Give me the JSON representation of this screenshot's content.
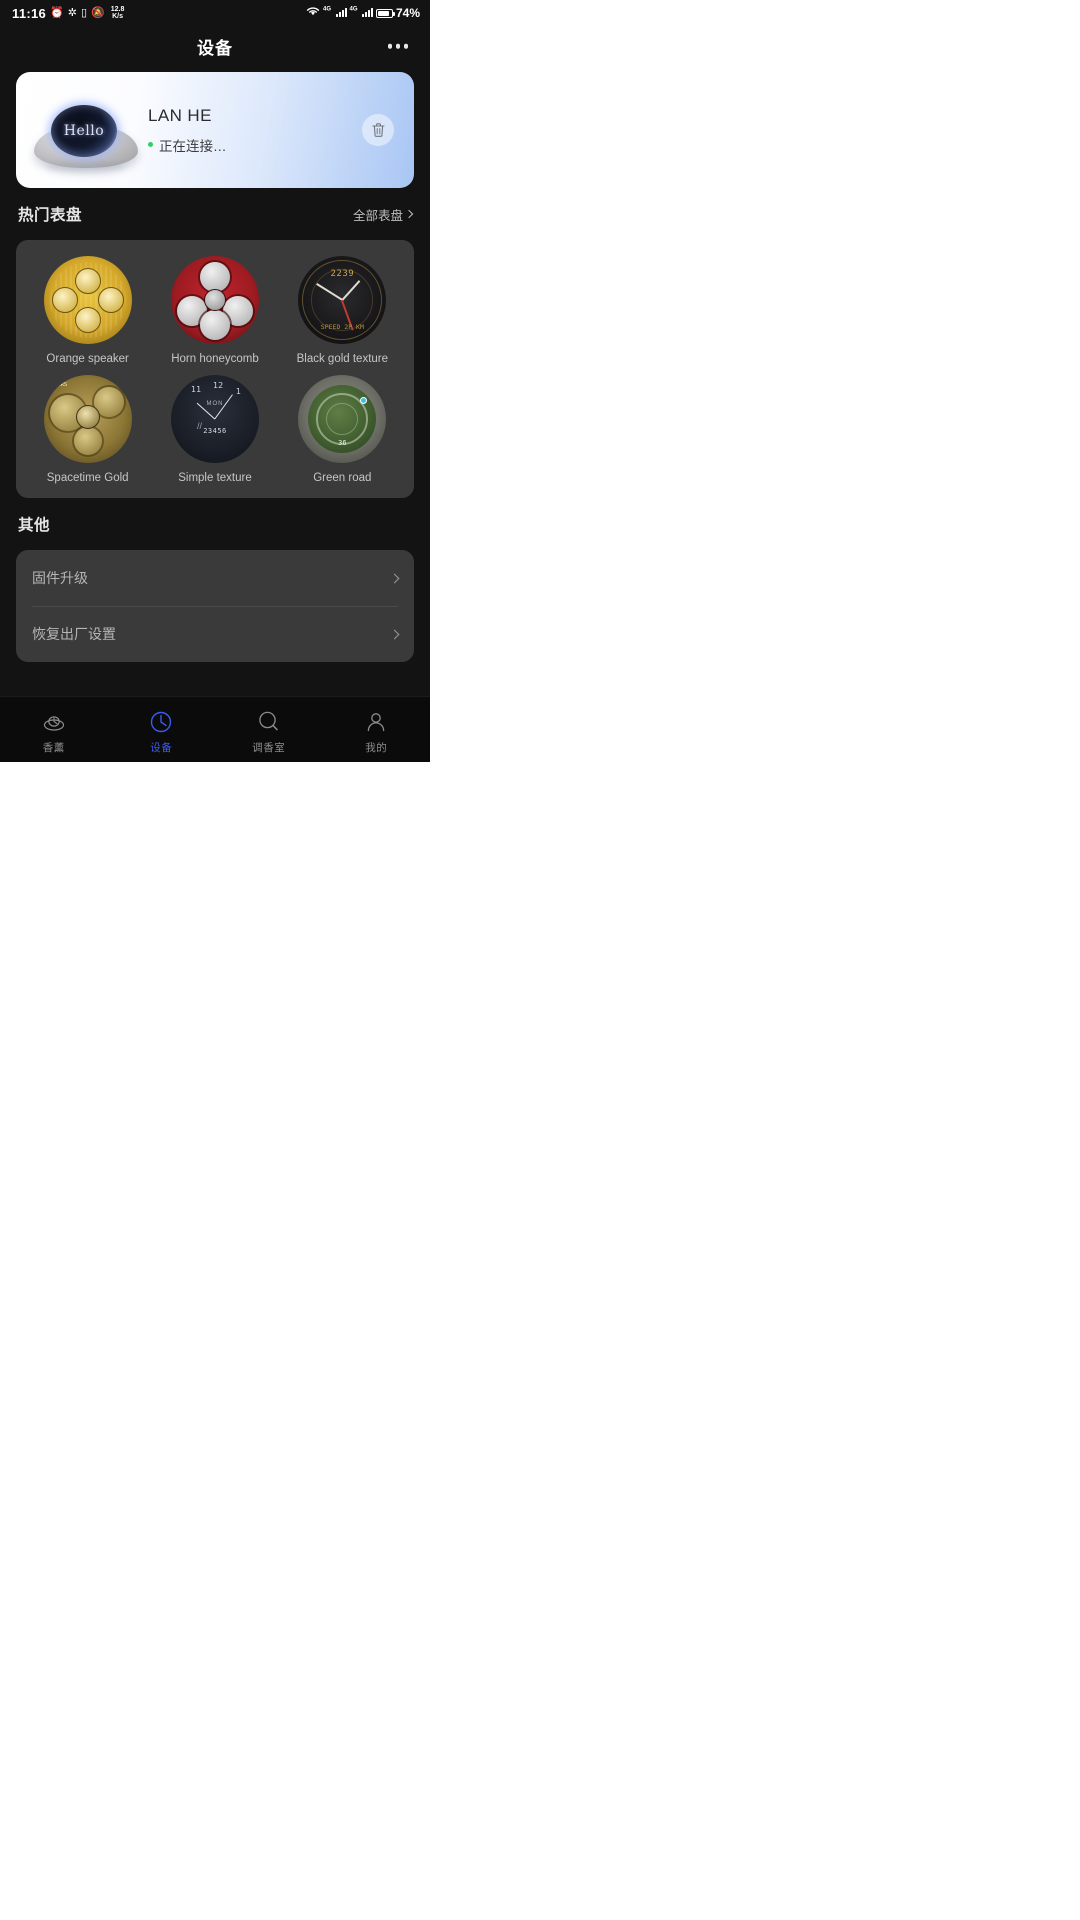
{
  "statusbar": {
    "time": "11:16",
    "alarm_icon": "alarm-icon",
    "bluetooth_icon": "bluetooth-icon",
    "mute_icon": "mute-bell-icon",
    "net_speed_value": "12.8",
    "net_speed_unit": "K/s",
    "wifi_icon": "wifi-icon",
    "sim1_label": "4G",
    "sim2_label": "4G",
    "battery_percent": "74%",
    "battery_level": 74
  },
  "header": {
    "title": "设备",
    "more_icon": "more-horizontal-icon"
  },
  "device_card": {
    "device_image_text": "Hello",
    "name": "LAN HE",
    "status": "正在连接…",
    "status_dot_color": "#2fd06a",
    "delete_icon": "trash-icon"
  },
  "watchfaces_section": {
    "title": "热门表盘",
    "link_label": "全部表盘",
    "link_chevron_icon": "chevron-right-icon",
    "faces": [
      {
        "label": "Orange speaker",
        "style": "f1"
      },
      {
        "label": "Horn honeycomb",
        "style": "f2"
      },
      {
        "label": "Black gold texture",
        "style": "f3"
      },
      {
        "label": "Spacetime Gold",
        "style": "f4"
      },
      {
        "label": "Simple texture",
        "style": "f5"
      },
      {
        "label": "Green road",
        "style": "f6"
      }
    ]
  },
  "watchface_art": {
    "black_gold_top": "2239",
    "black_gold_bottom": "SPEED 2P KM",
    "spacetime_text": "GEARS",
    "simple_n11": "11",
    "simple_n12": "12",
    "simple_n1": "1",
    "simple_month": "MON",
    "simple_digits": "23456",
    "green_num": "36"
  },
  "other_section": {
    "title": "其他",
    "rows": [
      {
        "label": "固件升级",
        "chevron_icon": "chevron-right-icon"
      },
      {
        "label": "恢复出厂设置",
        "chevron_icon": "chevron-right-icon"
      }
    ]
  },
  "tabbar": {
    "items": [
      {
        "label": "香薰",
        "icon": "aroma-diffuser-icon",
        "active": false
      },
      {
        "label": "设备",
        "icon": "clock-device-icon",
        "active": true
      },
      {
        "label": "调香室",
        "icon": "search-magnifier-icon",
        "active": false
      },
      {
        "label": "我的",
        "icon": "person-profile-icon",
        "active": false
      }
    ]
  },
  "colors": {
    "background": "#141313",
    "card": "#3a3a3a",
    "accent": "#3b5bf0",
    "status_green": "#2fd06a"
  }
}
